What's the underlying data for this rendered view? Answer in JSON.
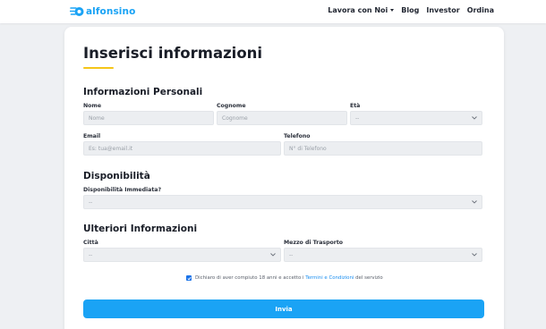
{
  "header": {
    "logo_text": "alfonsino",
    "nav": [
      {
        "label": "Lavora con Noi"
      },
      {
        "label": "Blog"
      },
      {
        "label": "Investor"
      },
      {
        "label": "Ordina"
      }
    ],
    "colors": {
      "brand": "#1aa3f5",
      "accent": "#f5c518"
    }
  },
  "form": {
    "title": "Inserisci informazioni",
    "personal": {
      "heading": "Informazioni Personali",
      "nome_label": "Nome",
      "nome_placeholder": "Nome",
      "cognome_label": "Cognome",
      "cognome_placeholder": "Cognome",
      "eta_label": "Età",
      "eta_value": "--",
      "email_label": "Email",
      "email_placeholder": "Es: tua@email.it",
      "telefono_label": "Telefono",
      "telefono_placeholder": "N° di Telefono"
    },
    "availability": {
      "heading": "Disponibilità",
      "immediate_label": "Disponibilità Immediata?",
      "immediate_value": "--"
    },
    "additional": {
      "heading": "Ulteriori Informazioni",
      "citta_label": "Città",
      "citta_value": "--",
      "mezzo_label": "Mezzo di Trasporto",
      "mezzo_value": "--"
    },
    "consent": {
      "checked": true,
      "text_before": "Dichiaro di aver compiuto 18 anni e accetto i ",
      "link_text": "Termini e Condizioni",
      "text_after": " del servizio"
    },
    "submit_label": "Invia"
  }
}
